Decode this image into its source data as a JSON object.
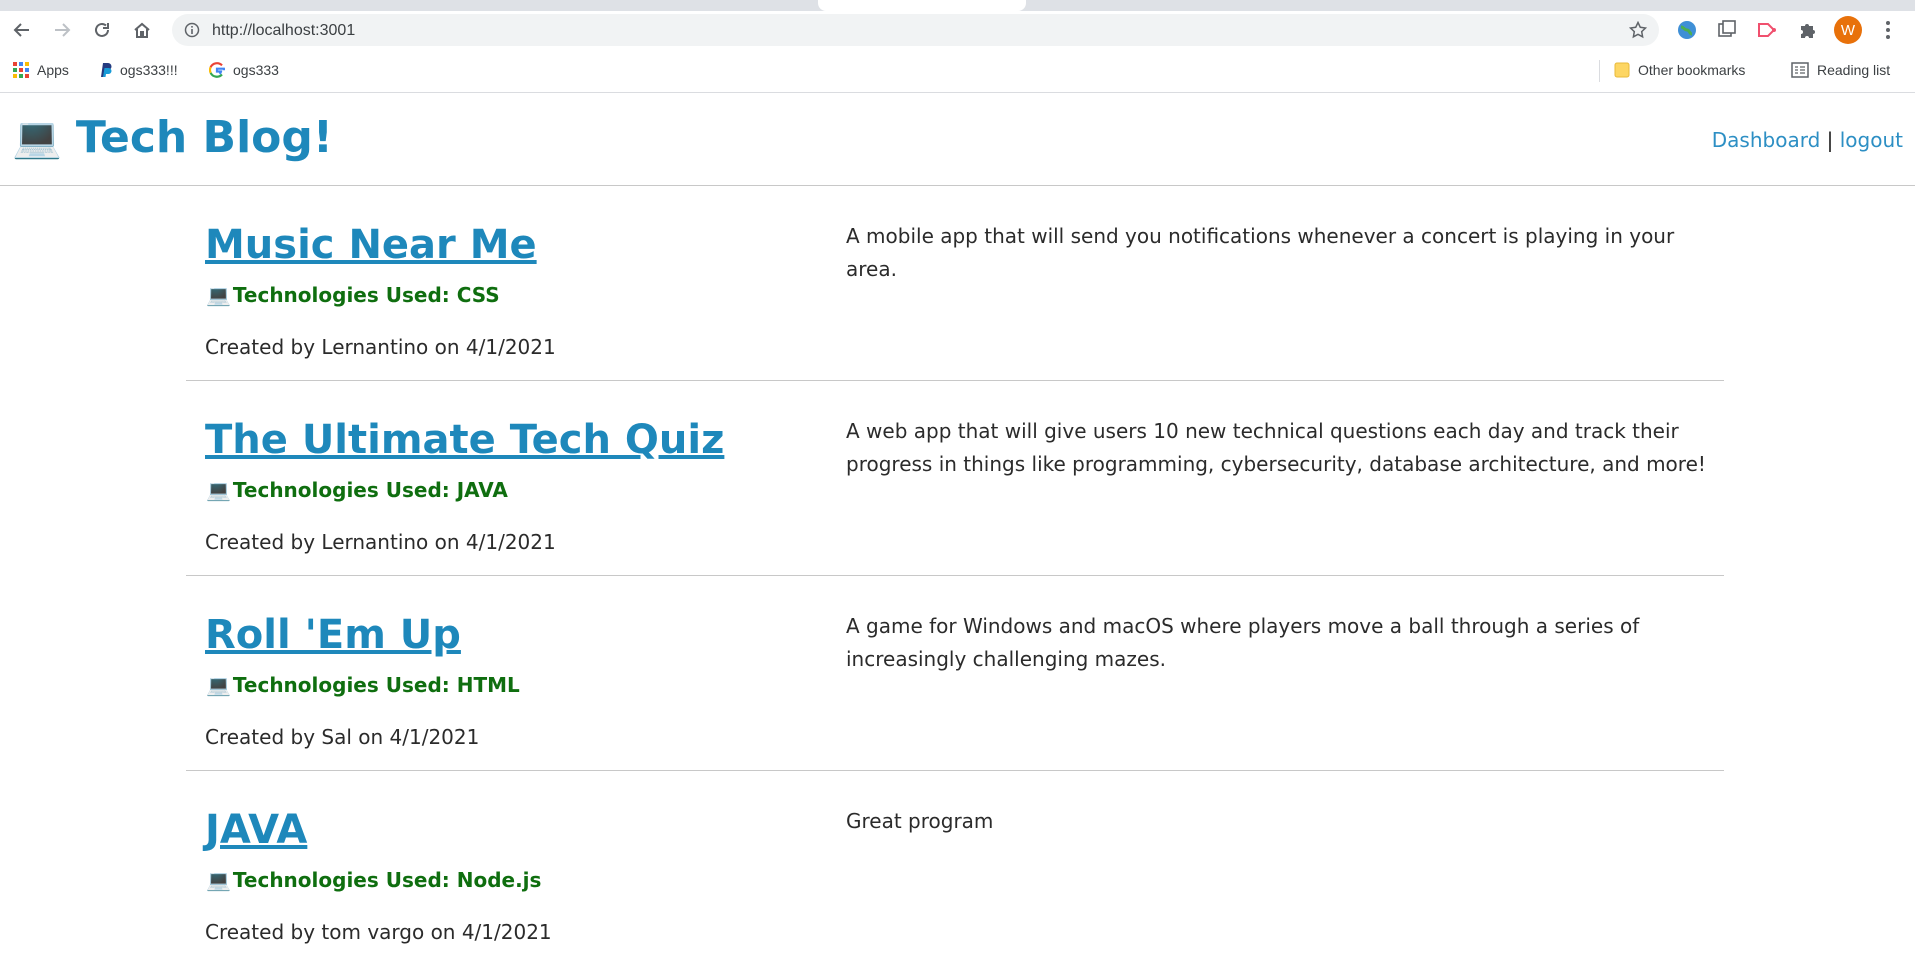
{
  "browser": {
    "url": "http://localhost:3001",
    "bookmarks": [
      {
        "label": "Apps",
        "icon": "apps-grid-icon"
      },
      {
        "label": "ogs333!!!",
        "icon": "paypal-icon"
      },
      {
        "label": "ogs333",
        "icon": "google-icon"
      }
    ],
    "other_bookmarks": "Other bookmarks",
    "reading_list": "Reading list",
    "profile_initial": "W"
  },
  "site": {
    "title": "Tech Blog!",
    "title_icon": "💻",
    "nav": {
      "dashboard": "Dashboard",
      "separator": "|",
      "logout": "logout"
    }
  },
  "posts": [
    {
      "title": "Music Near Me",
      "tech": "Technologies Used: CSS",
      "meta": "Created by Lernantino on 4/1/2021",
      "description": "A mobile app that will send you notifications whenever a concert is playing in your area."
    },
    {
      "title": "The Ultimate Tech Quiz",
      "tech": "Technologies Used: JAVA",
      "meta": "Created by Lernantino on 4/1/2021",
      "description": "A web app that will give users 10 new technical questions each day and track their progress in things like programming, cybersecurity, database architecture, and more!"
    },
    {
      "title": "Roll 'Em Up",
      "tech": "Technologies Used: HTML",
      "meta": "Created by Sal on 4/1/2021",
      "description": "A game for Windows and macOS where players move a ball through a series of increasingly challenging mazes."
    },
    {
      "title": "JAVA",
      "tech": "Technologies Used: Node.js",
      "meta": "Created by tom vargo on 4/1/2021",
      "description": "Great program"
    }
  ],
  "post_icon": "💻",
  "colors": {
    "accent": "#1e88bb",
    "tech": "#0f6e0f",
    "link": "#2d8fc4"
  }
}
